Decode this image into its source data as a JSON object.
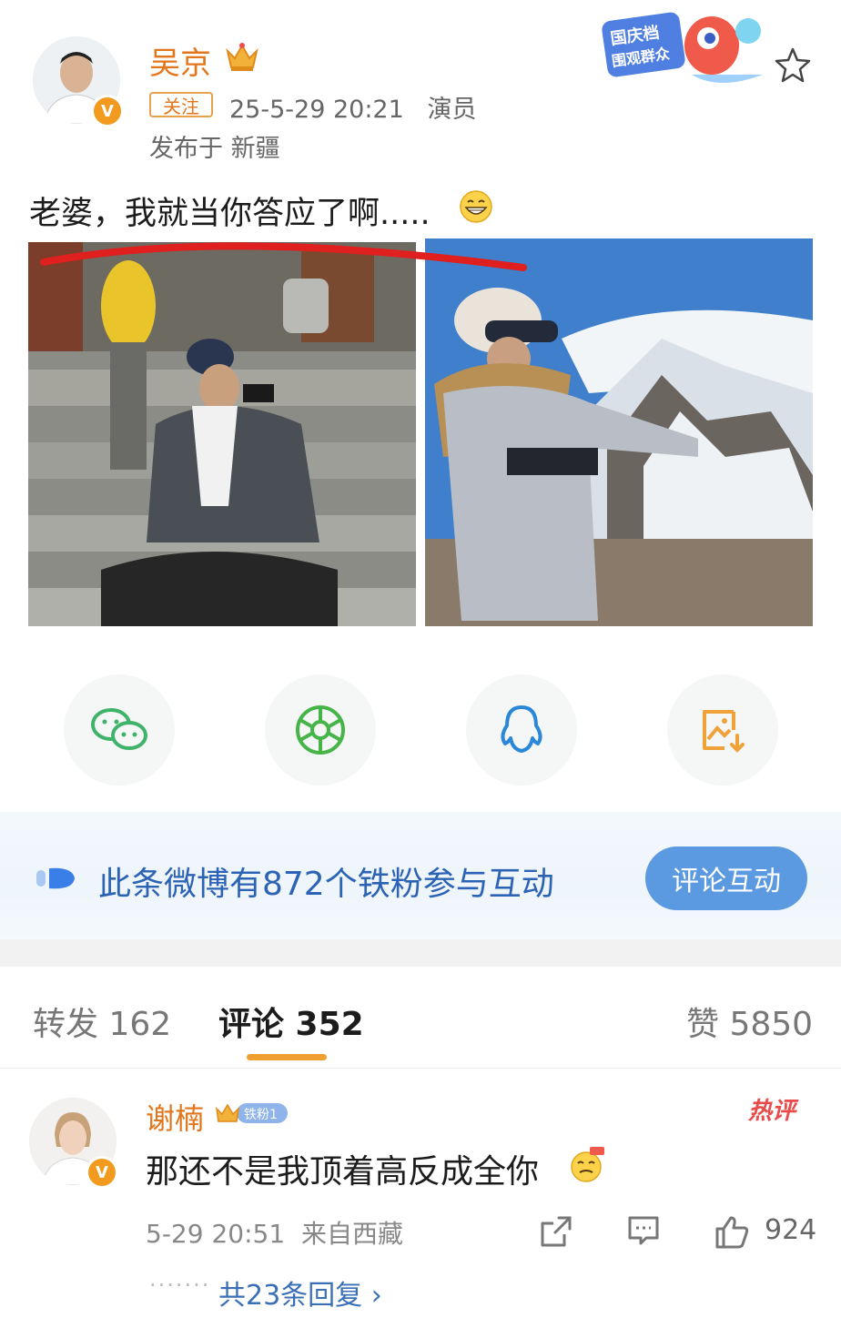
{
  "post": {
    "author": "吴京",
    "follow_label": "关注",
    "meta": "25-5-29 20:21   演员",
    "location": "发布于 新疆",
    "text": "老婆，我就当你答应了啊.....",
    "sticker_text": [
      "国庆档",
      "围观群众"
    ]
  },
  "share": {
    "items": [
      {
        "icon": "wechat-icon"
      },
      {
        "icon": "moments-icon"
      },
      {
        "icon": "qq-icon"
      },
      {
        "icon": "save-image-icon"
      }
    ]
  },
  "fan_banner": {
    "text": "此条微博有872个铁粉参与互动",
    "button": "评论互动"
  },
  "tabs": {
    "repost": "转发 162",
    "comments": "评论 352",
    "likes": "赞 5850"
  },
  "comment": {
    "author": "谢楠",
    "badge": "铁粉1",
    "hot_tag": "热评",
    "text": "那还不是我顶着高反成全你",
    "time": "5-29 20:51  来自西藏",
    "likes": "924",
    "replies": "共23条回复 ›"
  },
  "colors": {
    "accent_orange": "#e2761c",
    "link_blue": "#2d63b5",
    "button_blue": "#5b99e0",
    "hot_red": "#e94b4b"
  }
}
